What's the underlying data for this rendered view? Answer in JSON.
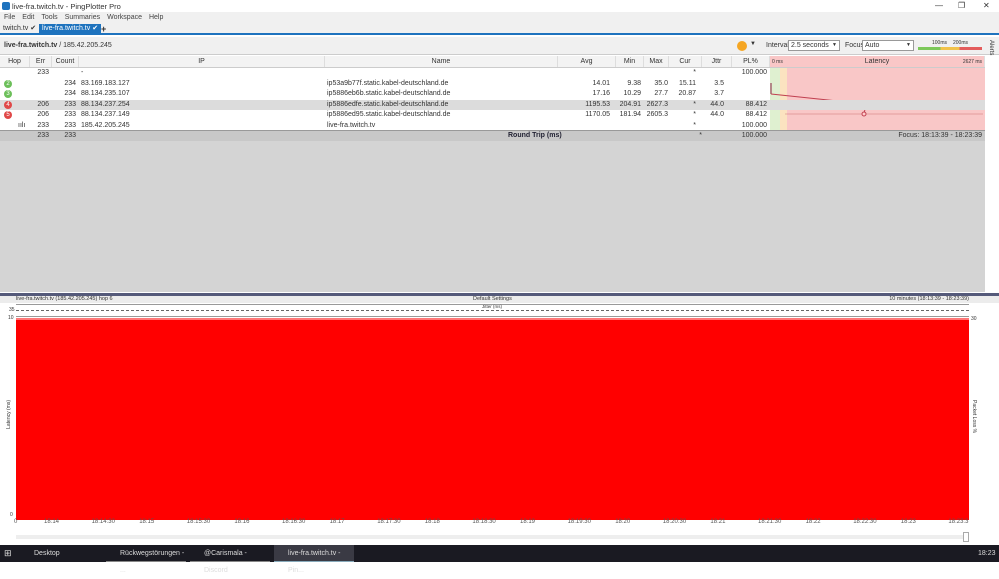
{
  "window": {
    "title": "live-fra.twitch.tv - PingPlotter Pro"
  },
  "menu": [
    "File",
    "Edit",
    "Tools",
    "Summaries",
    "Workspace",
    "Help"
  ],
  "tabs": [
    {
      "label": "twitch.tv"
    },
    {
      "label": "live-fra.twitch.tv"
    }
  ],
  "header": {
    "target": "live-fra.twitch.tv",
    "ip": " / 185.42.205.245",
    "interval_label": "Interval",
    "interval_value": "2.5 seconds",
    "focus_label": "Focus",
    "focus_value": "Auto",
    "scale_100": "100ms",
    "scale_200": "200ms",
    "alerts": "Alerts"
  },
  "columns": [
    "Hop",
    "Err",
    "Count",
    "IP",
    "Name",
    "Avg",
    "Min",
    "Max",
    "Cur",
    "Jttr",
    "PL%",
    "Latency"
  ],
  "latency_scale": {
    "min": "0 ms",
    "max": "2627 ms"
  },
  "rows": [
    {
      "hop": "",
      "err": "233",
      "count": "",
      "ip": "-",
      "name": "",
      "avg": "",
      "min": "",
      "max": "",
      "cur": "*",
      "jttr": "",
      "pl": "100.000"
    },
    {
      "hop": "2",
      "err": "",
      "count": "234",
      "ip": "83.169.183.127",
      "name": "ip53a9b77f.static.kabel-deutschland.de",
      "avg": "14.01",
      "min": "9.38",
      "max": "35.0",
      "cur": "15.11",
      "jttr": "3.5",
      "pl": ""
    },
    {
      "hop": "3",
      "err": "",
      "count": "234",
      "ip": "88.134.235.107",
      "name": "ip5886eb6b.static.kabel-deutschland.de",
      "avg": "17.16",
      "min": "10.29",
      "max": "27.7",
      "cur": "20.87",
      "jttr": "3.7",
      "pl": ""
    },
    {
      "hop": "4",
      "err": "206",
      "count": "233",
      "ip": "88.134.237.254",
      "name": "ip5886edfe.static.kabel-deutschland.de",
      "avg": "1195.53",
      "min": "204.91",
      "max": "2627.3",
      "cur": "*",
      "jttr": "44.0",
      "pl": "88.412"
    },
    {
      "hop": "5",
      "err": "206",
      "count": "233",
      "ip": "88.134.237.149",
      "name": "ip5886ed95.static.kabel-deutschland.de",
      "avg": "1170.05",
      "min": "181.94",
      "max": "2605.3",
      "cur": "*",
      "jttr": "44.0",
      "pl": "88.412"
    },
    {
      "hop": "",
      "err": "233",
      "count": "233",
      "ip": "185.42.205.245",
      "name": "live-fra.twitch.tv",
      "avg": "",
      "min": "",
      "max": "",
      "cur": "*",
      "jttr": "",
      "pl": "100.000"
    }
  ],
  "summary": {
    "err": "233",
    "count": "233",
    "label": "Round Trip (ms)",
    "cur": "*",
    "pl": "100.000",
    "focus": "Focus: 18:13:39 - 18:23:39"
  },
  "graph": {
    "title_left": "live-fra.twitch.tv (185.42.205.245) hop 6",
    "title_center": "Default Settings",
    "title_right": "10 minutes (18:13:39 - 18:23:39)",
    "jitter_label": "Jitter (ms)",
    "jitter_max": "35",
    "y_max": "10",
    "y_min": "0",
    "y_label": "Latency (ms)",
    "y2_max": "30",
    "y2_label": "Packet Loss %",
    "x_ticks": [
      "0",
      "18:14",
      "18:14:30",
      "18:15",
      "18:15:30",
      "18:16",
      "18:16:30",
      "18:17",
      "18:17:30",
      "18:18",
      "18:18:30",
      "18:19",
      "18:19:30",
      "18:20",
      "18:20:30",
      "18:21",
      "18:21:30",
      "18:22",
      "18:22:30",
      "18:23",
      "18:23:3"
    ],
    "packet_loss_percent": 100
  },
  "taskbar": {
    "items": [
      "Desktop",
      "Rückwegstörungen - ...",
      "@Carismala - Discord",
      "live-fra.twitch.tv - Pin..."
    ],
    "time": "18:23"
  }
}
